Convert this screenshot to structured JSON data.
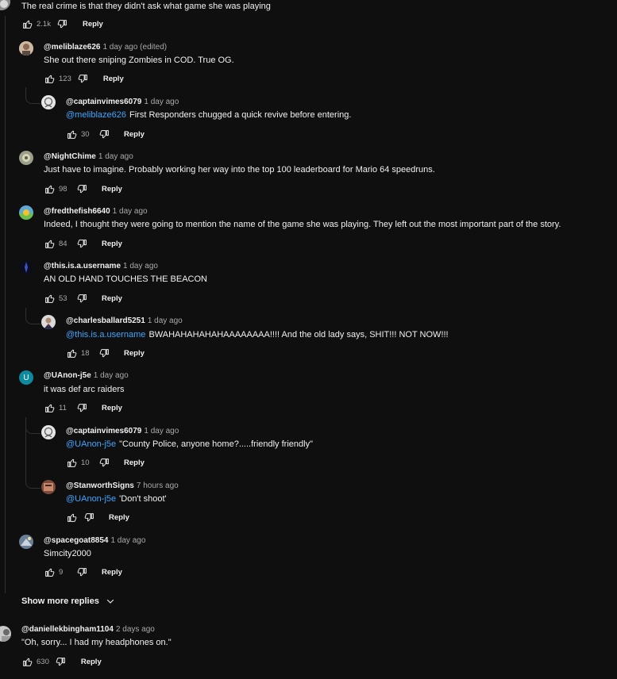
{
  "comments": [
    {
      "id": "c0",
      "author": "",
      "time": "",
      "text": "The real crime is that they didn't  ask what game she was playing",
      "likes": "2.1k",
      "reply": "Reply"
    },
    {
      "id": "c1",
      "author": "@meliblaze626",
      "time": "1 day ago (edited)",
      "text": "She out there sniping Zombies in COD. True OG.",
      "likes": "123",
      "reply": "Reply"
    },
    {
      "id": "c2",
      "author": "@captainvimes6079",
      "time": "1 day ago",
      "mention": "@meliblaze626",
      "text": "First Responders chugged a quick revive before entering.",
      "likes": "30",
      "reply": "Reply"
    },
    {
      "id": "c3",
      "author": "@NightChime",
      "time": "1 day ago",
      "text": "Just have to imagine.  Probably working her way into the top 100 leaderboard for Mario 64 speedruns.",
      "likes": "98",
      "reply": "Reply"
    },
    {
      "id": "c4",
      "author": "@fredthefish6640",
      "time": "1 day ago",
      "text": "Indeed, I thought they were going to mention the name of the game she was playing. They left out the most important part of the story.",
      "likes": "84",
      "reply": "Reply"
    },
    {
      "id": "c5",
      "author": "@this.is.a.username",
      "time": "1 day ago",
      "text": "AN OLD HAND TOUCHES THE BEACON",
      "likes": "53",
      "reply": "Reply"
    },
    {
      "id": "c6",
      "author": "@charlesballard5251",
      "time": "1 day ago",
      "mention": "@this.is.a.username",
      "text": "BWAHAHAHAHAHAAAAAAAA!!!!  And the old lady says, SHIT!!!  NOT NOW!!!",
      "likes": "18",
      "reply": "Reply"
    },
    {
      "id": "c7",
      "author": "@UAnon-j5e",
      "time": "1 day ago",
      "text": "it was def arc raiders",
      "likes": "11",
      "reply": "Reply",
      "avatar_letter": "U"
    },
    {
      "id": "c8",
      "author": "@captainvimes6079",
      "time": "1 day ago",
      "mention": "@UAnon-j5e",
      "text": "\"County Police, anyone home?.....friendly friendly\"",
      "likes": "10",
      "reply": "Reply"
    },
    {
      "id": "c9",
      "author": "@StanworthSigns",
      "time": "7 hours ago",
      "mention": "@UAnon-j5e",
      "text": "'Don't shoot'",
      "likes": "",
      "reply": "Reply"
    },
    {
      "id": "c10",
      "author": "@spacegoat8854",
      "time": "1 day ago",
      "text": "Simcity2000",
      "likes": "9",
      "reply": "Reply"
    },
    {
      "id": "c11",
      "author": "@daniellekbingham1104",
      "time": "2 days ago",
      "text": "\"Oh, sorry... I had my headphones on.\"",
      "likes": "630",
      "reply": "Reply"
    }
  ],
  "show_more": {
    "label": "Show more replies"
  },
  "colors": {
    "background": "#0f0f0f",
    "mention": "#3ea6ff",
    "secondary_text": "#aaaaaa",
    "uanon_avatar": "#0e8a9e"
  },
  "icons": {
    "like": "thumbs-up-icon",
    "dislike": "thumbs-down-icon",
    "show_more": "chevron-down-icon"
  }
}
